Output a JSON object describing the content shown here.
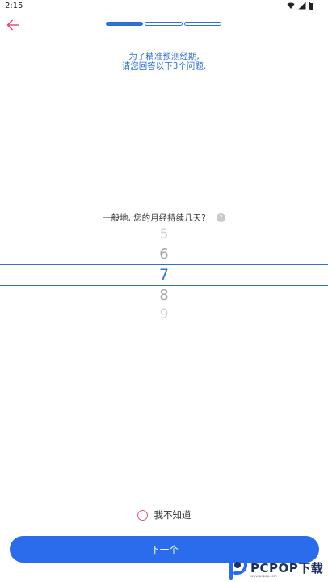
{
  "status_bar": {
    "time": "2:15"
  },
  "progress": {
    "total_steps": 3,
    "current_step": 1
  },
  "intro": {
    "line1": "为了精准预测经期,",
    "line2": "请您回答以下3个问题."
  },
  "question": {
    "text": "一般地, 您的月经持续几天?",
    "help_glyph": "?"
  },
  "picker": {
    "values": [
      "5",
      "6",
      "7",
      "8",
      "9"
    ],
    "selected": "7"
  },
  "dont_know_label": "我不知道",
  "next_button_label": "下一个",
  "watermark": {
    "text": "PCPOP下载",
    "sub": "www.pcpop.com"
  },
  "colors": {
    "accent": "#2f6fd6",
    "button": "#2a6cec",
    "back_arrow": "#e0537a"
  }
}
